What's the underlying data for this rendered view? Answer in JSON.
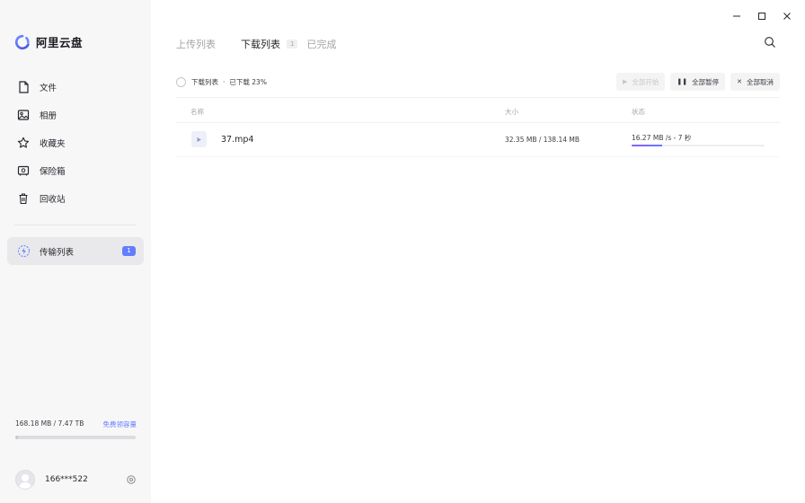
{
  "app": {
    "name": "阿里云盘",
    "accent": "#637dff"
  },
  "sidebar": {
    "items": [
      {
        "label": "文件",
        "icon": "file-icon"
      },
      {
        "label": "相册",
        "icon": "photo-icon"
      },
      {
        "label": "收藏夹",
        "icon": "star-icon"
      },
      {
        "label": "保险箱",
        "icon": "safe-icon"
      },
      {
        "label": "回收站",
        "icon": "trash-icon"
      }
    ],
    "transfer": {
      "label": "传输列表",
      "icon": "transfer-icon",
      "badge": "1"
    },
    "storage": {
      "used": "168.18 MB / 7.47 TB",
      "link": "免费领容量",
      "used_fraction": 0.02
    },
    "user": {
      "name": "166***522"
    }
  },
  "window": {
    "minimize": "minimize-icon",
    "maximize": "maximize-icon",
    "close": "close-icon"
  },
  "tabs": [
    {
      "label": "上传列表"
    },
    {
      "label": "下载列表",
      "count": "1"
    },
    {
      "label": "已完成"
    }
  ],
  "toolbar": {
    "list_label": "下载列表",
    "separator": "·",
    "progress_text": "已下载 23%",
    "start_all": "全部开始",
    "pause_all": "全部暂停",
    "cancel_all": "全部取消"
  },
  "table": {
    "headers": {
      "name": "名称",
      "size": "大小",
      "status": "状态"
    },
    "rows": [
      {
        "name": "37.mp4",
        "size": "32.35 MB / 138.14 MB",
        "status": "16.27 MB /s - 7 秒",
        "progress": 0.23
      }
    ]
  }
}
